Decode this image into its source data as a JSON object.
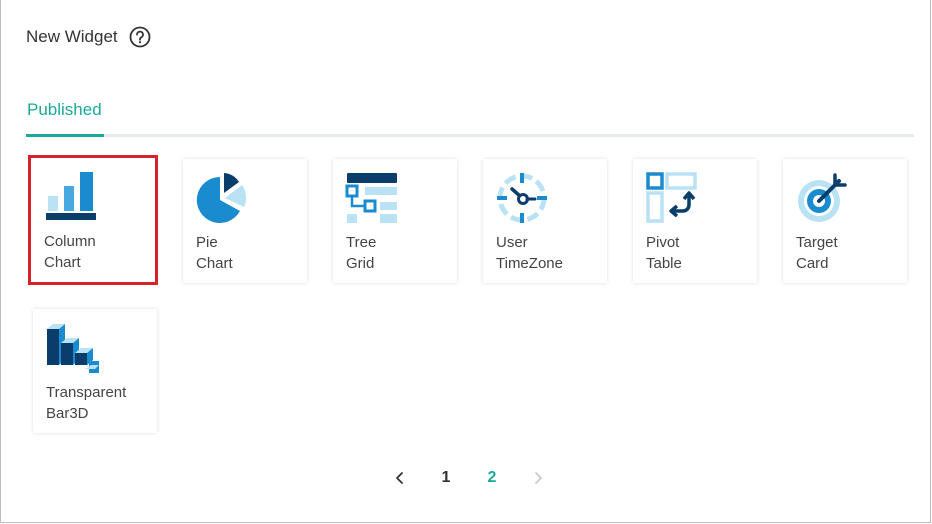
{
  "dialog": {
    "title": "New Widget",
    "help_icon": "question-circle-icon"
  },
  "tabs": [
    {
      "label": "Published",
      "active": true
    }
  ],
  "widgets": [
    {
      "label": "Column\nChart",
      "icon": "column-chart-icon",
      "selected": true
    },
    {
      "label": "Pie\nChart",
      "icon": "pie-chart-icon",
      "selected": false
    },
    {
      "label": "Tree\nGrid",
      "icon": "tree-grid-icon",
      "selected": false
    },
    {
      "label": "User\nTimeZone",
      "icon": "user-timezone-icon",
      "selected": false
    },
    {
      "label": "Pivot\nTable",
      "icon": "pivot-table-icon",
      "selected": false
    },
    {
      "label": "Target\nCard",
      "icon": "target-card-icon",
      "selected": false
    },
    {
      "label": "Transparent\nBar3D",
      "icon": "transparent-bar3d-icon",
      "selected": false
    }
  ],
  "pagination": {
    "prev_icon": "chevron-left-icon",
    "pages": [
      "1",
      "2"
    ],
    "current_page": "2",
    "next_icon": "chevron-right-icon"
  },
  "colors": {
    "accent": "#1aa99a",
    "selection": "#d6222b",
    "icon_dark": "#0b3d6b",
    "icon_mid": "#1b8bd0",
    "icon_light": "#b9e2f5"
  }
}
